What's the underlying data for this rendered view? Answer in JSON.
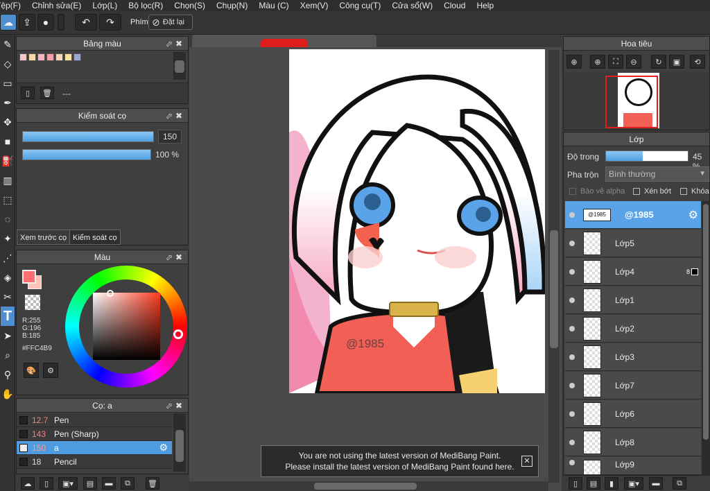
{
  "menu": [
    "Tệp(F)",
    "Chỉnh sửa(E)",
    "Lớp(L)",
    "Bộ lọc(R)",
    "Chọn(S)",
    "Chụp(N)",
    "Màu (C)",
    "Xem(V)",
    "Công cụ(T)",
    "Cửa sổ(W)",
    "Cloud",
    "Help"
  ],
  "toolbar": {
    "shortcut_label": "Phím",
    "reset_label": "Đặt lại"
  },
  "palette_panel": {
    "title": "Bảng màu",
    "label": "---",
    "colors": [
      "#f7c6c6",
      "#f9d9a9",
      "#f7b3c2",
      "#f5a0a8",
      "#f9d7b5",
      "#f8e3a0",
      "#9aa5d8"
    ]
  },
  "brush_control": {
    "title": "Kiểm soát cọ",
    "size_value": "150",
    "opacity_value": "100 %",
    "size_fraction": 1.0,
    "opacity_fraction": 1.0,
    "tab_preview": "Xem trước cọ",
    "tab_control": "Kiểm soát cọ"
  },
  "color_panel": {
    "title": "Màu",
    "r": "R:255",
    "g": "G:196",
    "b": "B:185",
    "hex": "#FFC4B9",
    "fg_color": "#ff6f6f"
  },
  "brush_panel": {
    "title": "Cọ: a",
    "brushes": [
      {
        "size": "12.7",
        "name": "Pen",
        "selected": false
      },
      {
        "size": "143",
        "name": "Pen (Sharp)",
        "selected": false
      },
      {
        "size": "150",
        "name": "a",
        "selected": true
      },
      {
        "size": "18",
        "name": "Pencil",
        "selected": false
      }
    ]
  },
  "canvas": {
    "watermark": "@1985"
  },
  "notice": {
    "line1": "You are not using the latest version of MediBang Paint.",
    "line2": "Please install the latest version of MediBang Paint found here.",
    "close": "✕"
  },
  "navigator": {
    "title": "Hoa tiêu"
  },
  "layer_panel": {
    "title": "Lớp",
    "opacity_label": "Độ trong",
    "opacity_value": "45 %",
    "opacity_fraction": 0.45,
    "blend_label": "Pha trộn",
    "blend_value": "Bình thường",
    "protect_alpha": "Bảo vệ alpha",
    "clipping": "Xén bớt",
    "lock": "Khóa",
    "layers": [
      {
        "name": "@1985",
        "selected": true
      },
      {
        "name": "Lớp5",
        "selected": false
      },
      {
        "name": "Lớp4",
        "selected": false,
        "badge": "8"
      },
      {
        "name": "Lớp1",
        "selected": false
      },
      {
        "name": "Lớp2",
        "selected": false
      },
      {
        "name": "Lớp3",
        "selected": false
      },
      {
        "name": "Lớp7",
        "selected": false
      },
      {
        "name": "Lớp6",
        "selected": false
      },
      {
        "name": "Lớp8",
        "selected": false
      },
      {
        "name": "Lớp9",
        "selected": false
      }
    ]
  }
}
